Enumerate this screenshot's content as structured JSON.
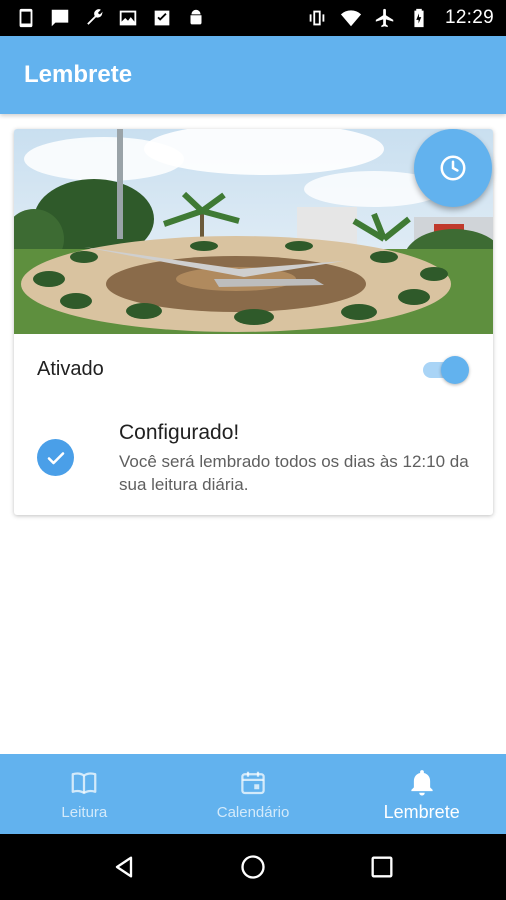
{
  "status_bar": {
    "time": "12:29",
    "left_icons": [
      "phone-icon",
      "message-icon",
      "wrench-icon",
      "image-icon",
      "check-icon",
      "android-icon"
    ],
    "right_icons": [
      "vibrate-icon",
      "wifi-icon",
      "airplane-icon",
      "battery-charging-icon"
    ]
  },
  "app_bar": {
    "title": "Lembrete"
  },
  "reminder_card": {
    "toggle_label": "Ativado",
    "toggle_on": true,
    "status_title": "Configurado!",
    "status_description": "Você será lembrado todos os dias às 12:10 da sua leitura diária."
  },
  "bottom_nav": {
    "items": [
      {
        "label": "Leitura",
        "icon": "book-icon"
      },
      {
        "label": "Calendário",
        "icon": "calendar-icon"
      },
      {
        "label": "Lembrete",
        "icon": "bell-icon",
        "active": true
      }
    ]
  },
  "colors": {
    "primary": "#62b2ee",
    "check": "#4a9fe8",
    "status_bar": "#000000"
  }
}
